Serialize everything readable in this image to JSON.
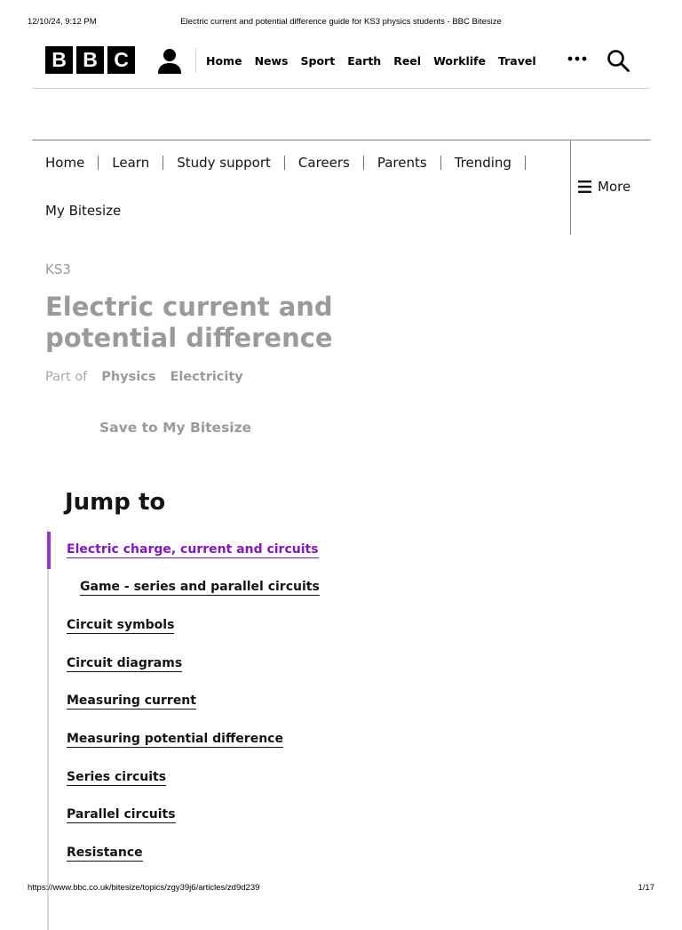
{
  "print": {
    "datetime": "12/10/24, 9:12 PM",
    "doc_title": "Electric current and potential difference guide for KS3 physics students - BBC Bitesize",
    "url": "https://www.bbc.co.uk/bitesize/topics/zgy39j6/articles/zd9d239",
    "page_indicator": "1/17"
  },
  "bbc_header": {
    "logo_letters": [
      "B",
      "B",
      "C"
    ],
    "nav": [
      "Home",
      "News",
      "Sport",
      "Earth",
      "Reel",
      "Worklife",
      "Travel"
    ],
    "icons": {
      "account": "account-icon",
      "more": "more-dots-icon",
      "search": "search-icon"
    }
  },
  "bitesize_nav": {
    "links": [
      "Home",
      "Learn",
      "Study support",
      "Careers",
      "Parents",
      "Trending"
    ],
    "my_bitesize": "My Bitesize",
    "more_label": "More"
  },
  "article": {
    "kicker": "KS3",
    "title": "Electric current and potential difference",
    "part_of_label": "Part of",
    "breadcrumbs": [
      "Physics",
      "Electricity"
    ],
    "save_label": "Save to My Bitesize"
  },
  "jump_to": {
    "heading": "Jump to",
    "active_color": "#8317c6",
    "items": [
      "Electric charge, current and circuits",
      "Game - series and parallel circuits",
      "Circuit symbols",
      "Circuit diagrams",
      "Measuring current",
      "Measuring potential difference",
      "Series circuits",
      "Parallel circuits",
      "Resistance"
    ]
  }
}
